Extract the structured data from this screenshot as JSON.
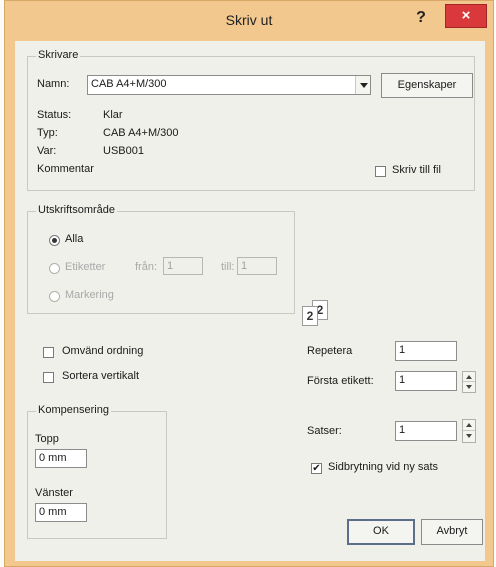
{
  "dialog": {
    "title": "Skriv ut",
    "help": "?",
    "close": "×"
  },
  "printer": {
    "legend": "Skrivare",
    "name_label": "Namn:",
    "name_value": "CAB A4+M/300",
    "properties_button": "Egenskaper",
    "status_label": "Status:",
    "status_value": "Klar",
    "type_label": "Typ:",
    "type_value": "CAB A4+M/300",
    "where_label": "Var:",
    "where_value": "USB001",
    "comment_label": "Kommentar",
    "print_to_file": "Skriv till fil",
    "print_to_file_checked": false
  },
  "range": {
    "legend": "Utskriftsområde",
    "all": "Alla",
    "labels": "Etiketter",
    "from_label": "från:",
    "from_value": "1",
    "to_label": "till:",
    "to_value": "1",
    "selection": "Markering",
    "selected": "all"
  },
  "collate_icon_pages": [
    "2",
    "2"
  ],
  "options": {
    "reverse_order": "Omvänd ordning",
    "reverse_checked": false,
    "sort_vertical": "Sortera vertikalt",
    "sort_checked": false
  },
  "compensation": {
    "legend": "Kompensering",
    "top_label": "Topp",
    "top_value": "0 mm",
    "left_label": "Vänster",
    "left_value": "0 mm"
  },
  "copies": {
    "repeat_label": "Repetera",
    "repeat_value": "1",
    "first_label_label": "Första etikett:",
    "first_label_value": "1",
    "sets_label": "Satser:",
    "sets_value": "1",
    "page_break_label": "Sidbrytning vid ny sats",
    "page_break_checked": true
  },
  "buttons": {
    "ok": "OK",
    "cancel": "Avbryt"
  }
}
